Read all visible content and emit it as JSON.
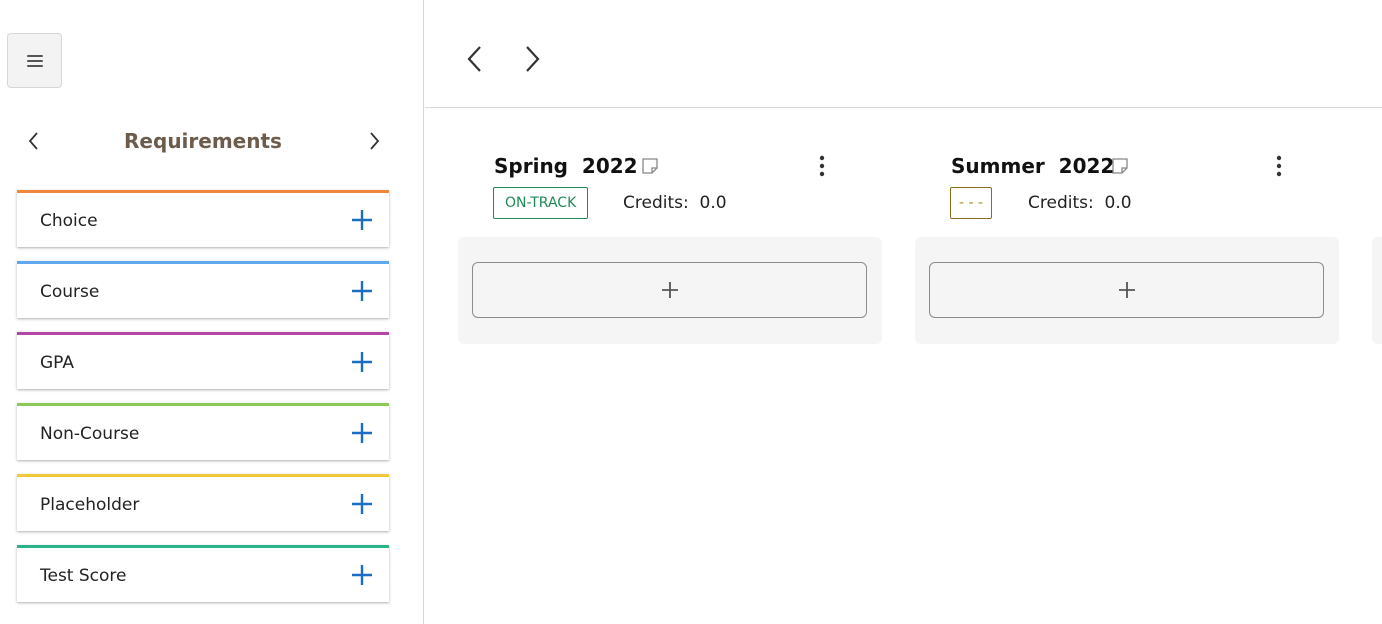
{
  "icons": {
    "menu": "hamburger-icon",
    "prev": "chevron-left-icon",
    "next": "chevron-right-icon",
    "add": "plus-icon",
    "note": "note-icon",
    "more": "more-vertical-icon"
  },
  "colors": {
    "requirements_title": "#6d5b4c",
    "add_icon": "#1b6ec2",
    "on_track": "#1f8a56",
    "no_status": "#a88a26"
  },
  "sidebar": {
    "title": "Requirements",
    "items": [
      {
        "label": "Choice",
        "color": "#f0883e"
      },
      {
        "label": "Course",
        "color": "#5fa8ef"
      },
      {
        "label": "GPA",
        "color": "#b447a6"
      },
      {
        "label": "Non-Course",
        "color": "#8bc956"
      },
      {
        "label": "Placeholder",
        "color": "#f0c93a"
      },
      {
        "label": "Test Score",
        "color": "#2bb28b"
      }
    ]
  },
  "terms": [
    {
      "title": "Spring  2022",
      "status": "ON-TRACK",
      "credits_label": "Credits:",
      "credits_value": "0.0"
    },
    {
      "title": "Summer  2022",
      "status": "- - -",
      "credits_label": "Credits:",
      "credits_value": "0.0"
    }
  ]
}
